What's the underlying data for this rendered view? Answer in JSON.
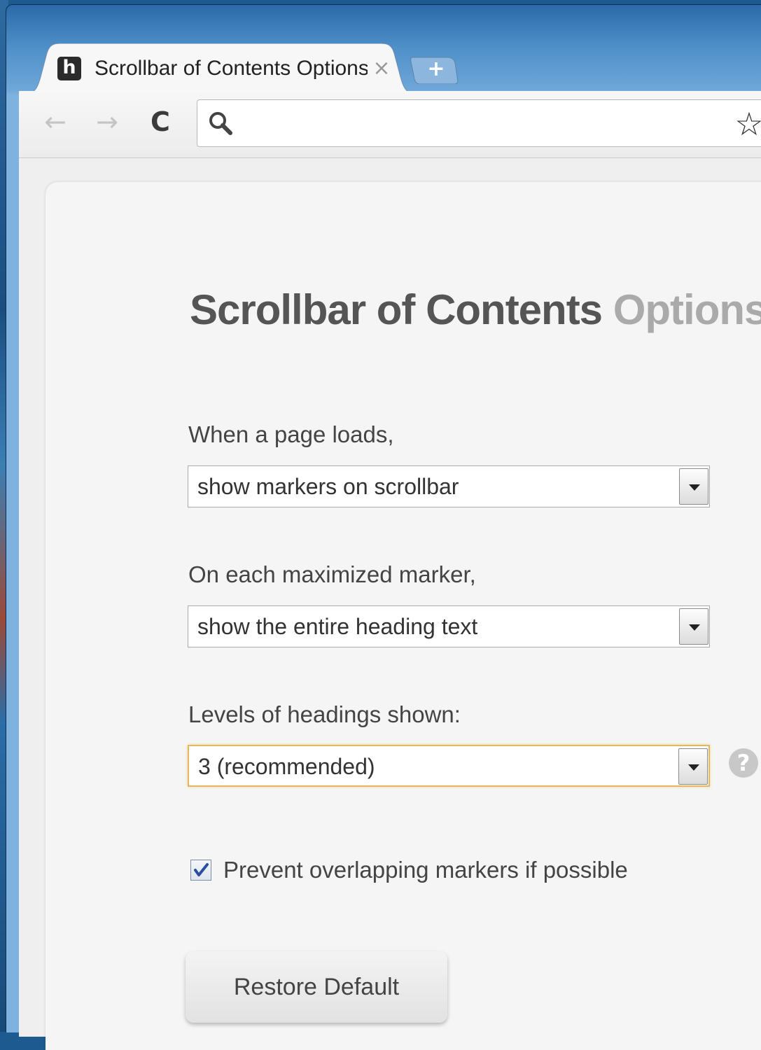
{
  "browser": {
    "tab": {
      "favicon_letter": "h",
      "title": "Scrollbar of Contents Options",
      "close_glyph": "×"
    },
    "new_tab_glyph": "+",
    "toolbar": {
      "back_glyph": "←",
      "forward_glyph": "→",
      "reload_glyph": "C",
      "address_value": "",
      "star_glyph": "☆"
    }
  },
  "page": {
    "title_main": "Scrollbar of Contents",
    "title_secondary": "Options",
    "settings": [
      {
        "label": "When a page loads,",
        "selected": "show markers on scrollbar"
      },
      {
        "label": "On each maximized marker,",
        "selected": "show the entire heading text"
      },
      {
        "label": "Levels of headings shown:",
        "selected": "3 (recommended)"
      }
    ],
    "help_glyph": "?",
    "checkbox": {
      "checked": true,
      "check_glyph": "✓",
      "label": "Prevent overlapping markers if possible"
    },
    "restore_button_label": "Restore Default"
  },
  "colors": {
    "focus_border": "#e0b964",
    "title_main": "#555555",
    "title_secondary": "#aaaaaa",
    "window_frame": "#4f8fc8"
  }
}
